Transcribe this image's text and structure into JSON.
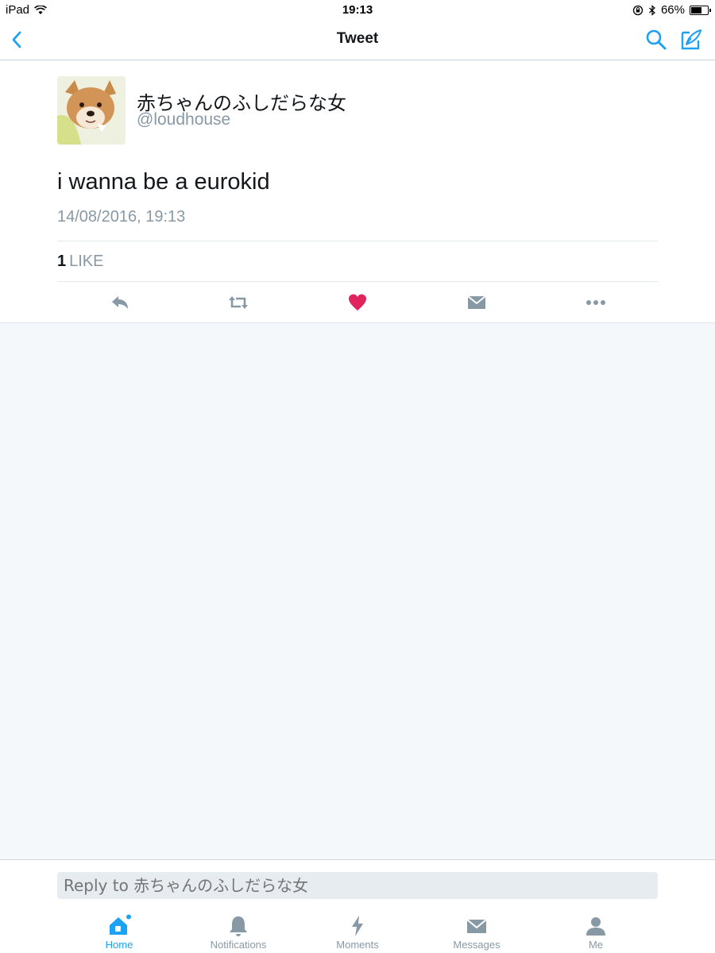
{
  "status_bar": {
    "device": "iPad",
    "time": "19:13",
    "battery": "66%",
    "battery_level": 0.66
  },
  "nav": {
    "title": "Tweet",
    "back_icon": "chevron-left-icon",
    "search_icon": "search-icon",
    "compose_icon": "compose-icon"
  },
  "tweet": {
    "author_name": "赤ちゃんのふしだらな女",
    "author_handle": "@loudhouse",
    "text": "i wanna be a eurokid",
    "timestamp": "14/08/2016, 19:13",
    "like_count": "1",
    "like_label": "LIKE",
    "actions": [
      "reply-icon",
      "retweet-icon",
      "like-icon",
      "direct-message-icon",
      "more-icon"
    ],
    "liked": true
  },
  "reply": {
    "placeholder": "Reply to 赤ちゃんのふしだらな女"
  },
  "tabs": [
    {
      "label": "Home",
      "icon": "home-icon",
      "active": true
    },
    {
      "label": "Notifications",
      "icon": "bell-icon",
      "active": false
    },
    {
      "label": "Moments",
      "icon": "lightning-icon",
      "active": false
    },
    {
      "label": "Messages",
      "icon": "envelope-icon",
      "active": false
    },
    {
      "label": "Me",
      "icon": "person-icon",
      "active": false
    }
  ],
  "colors": {
    "accent": "#1da1f2",
    "like": "#e0245e",
    "muted": "#8899a6",
    "background": "#f5f8fa"
  }
}
